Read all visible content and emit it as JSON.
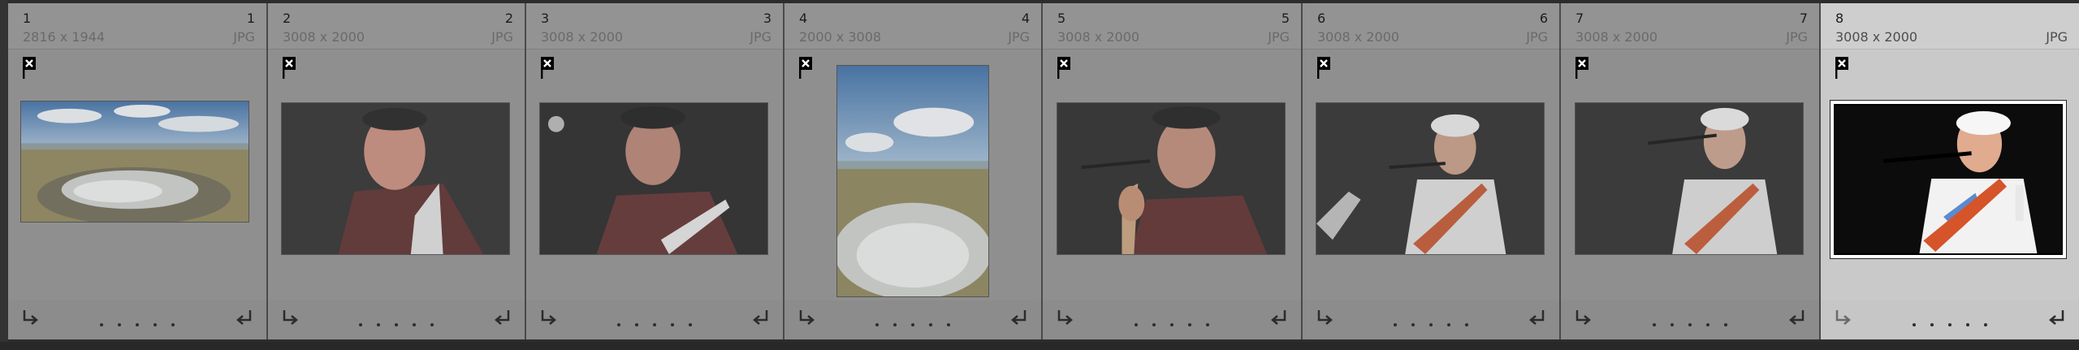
{
  "filmstrip": {
    "cells": [
      {
        "index": "1",
        "dims": "2816 x 1944",
        "type": "JPG",
        "scene": "landscape",
        "selected": false,
        "orientation": "landscape"
      },
      {
        "index": "2",
        "dims": "3008 x 2000",
        "type": "JPG",
        "scene": "singer-close",
        "selected": false,
        "orientation": "landscape"
      },
      {
        "index": "3",
        "dims": "3008 x 2000",
        "type": "JPG",
        "scene": "singer-guitar",
        "selected": false,
        "orientation": "landscape"
      },
      {
        "index": "4",
        "dims": "2000 x 3008",
        "type": "JPG",
        "scene": "landscape-portrait",
        "selected": false,
        "orientation": "portrait"
      },
      {
        "index": "5",
        "dims": "3008 x 2000",
        "type": "JPG",
        "scene": "singer-mic",
        "selected": false,
        "orientation": "landscape"
      },
      {
        "index": "6",
        "dims": "3008 x 2000",
        "type": "JPG",
        "scene": "guitarist-bandana",
        "selected": false,
        "orientation": "landscape"
      },
      {
        "index": "7",
        "dims": "3008 x 2000",
        "type": "JPG",
        "scene": "guitarist-bandana",
        "selected": false,
        "orientation": "landscape"
      },
      {
        "index": "8",
        "dims": "3008 x 2000",
        "type": "JPG",
        "scene": "guitarist-bandana-bright",
        "selected": true,
        "orientation": "landscape"
      }
    ]
  },
  "icons": {
    "flag": "rejected-flag-icon",
    "rotate_left": "rotate-left-icon",
    "rotate_right": "rotate-right-icon",
    "rating": "rating-dots"
  },
  "colors": {
    "cell_bg": "#8f8f8f",
    "selected_bg": "#c9c9c9",
    "divider": "#4a4a4a"
  }
}
